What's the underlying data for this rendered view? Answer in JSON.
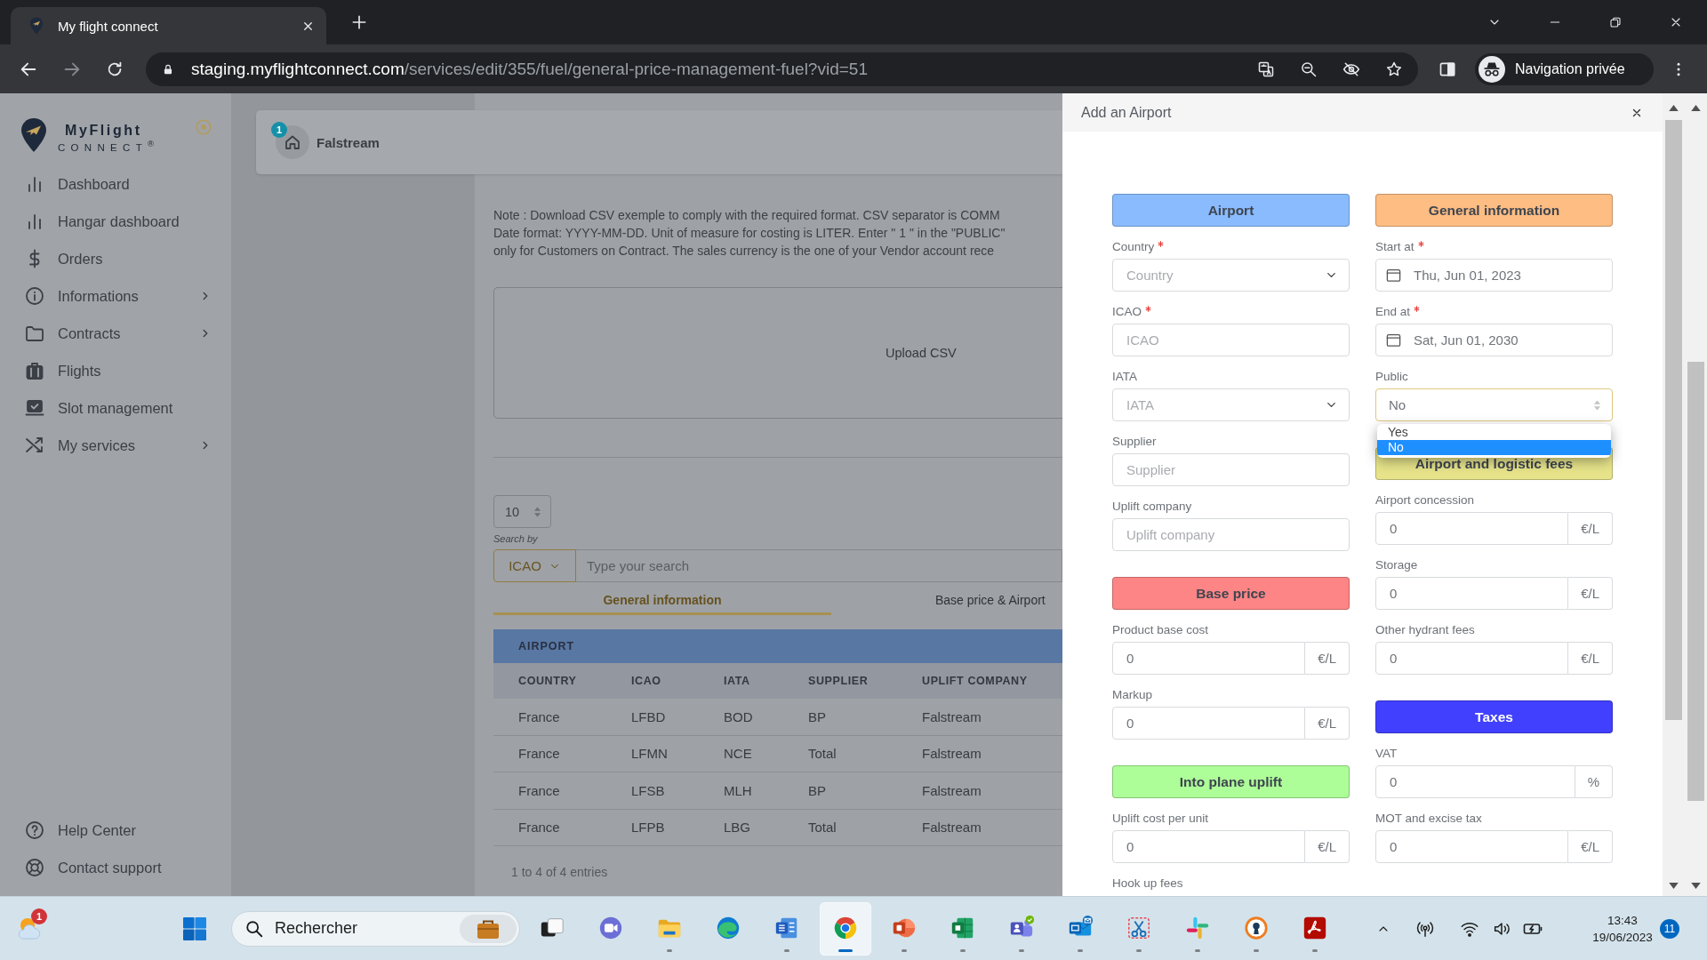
{
  "browser": {
    "tab": {
      "title": "My flight connect"
    },
    "address": {
      "host": "staging.myflightconnect.com",
      "path": "/services/edit/355/fuel/general-price-management-fuel?vid=51"
    },
    "profile": {
      "label": "Navigation privée"
    }
  },
  "sidebar": {
    "logo": {
      "name": "MyFlight",
      "tagline": "CONNECT$^{®}$"
    },
    "items": [
      {
        "label": "Dashboard",
        "expandable": false,
        "selected": false
      },
      {
        "label": "Hangar dashboard",
        "expandable": false,
        "selected": false
      },
      {
        "label": "Orders",
        "expandable": false,
        "selected": false
      },
      {
        "label": "Informations",
        "expandable": true,
        "selected": false
      },
      {
        "label": "Contracts",
        "expandable": true,
        "selected": false
      },
      {
        "label": "Flights",
        "expandable": false,
        "selected": false
      },
      {
        "label": "Slot management",
        "expandable": false,
        "selected": false
      },
      {
        "label": "My services",
        "expandable": true,
        "selected": false
      }
    ],
    "footer_items": [
      {
        "label": "Help Center",
        "expandable": false,
        "selected": false
      },
      {
        "label": "Contact support",
        "expandable": false,
        "selected": false
      }
    ]
  },
  "header": {
    "badge": "1",
    "company": "Falstream"
  },
  "content": {
    "note_lines": [
      "Note : Download CSV exemple to comply with the required format. CSV separator is COMM",
      "Date format: YYYY-MM-DD. Unit of measure for costing is LITER. Enter \" 1 \" in the \"PUBLIC\"",
      "only for Customers on Contract. The sales currency is the one of your Vendor account rece"
    ],
    "upload": {
      "label": "Upload CSV"
    },
    "page_size": {
      "value": "10"
    },
    "search": {
      "label": "Search by",
      "by": "ICAO",
      "placeholder": "Type your search"
    },
    "tabs": [
      {
        "label": "General information",
        "selected": true
      },
      {
        "label": "Base price & Airport",
        "selected": false
      }
    ],
    "table": {
      "group": "AIRPORT",
      "columns": [
        "COUNTRY",
        "ICAO",
        "IATA",
        "SUPPLIER",
        "UPLIFT COMPANY"
      ],
      "rows": [
        [
          "France",
          "LFBD",
          "BOD",
          "BP",
          "Falstream"
        ],
        [
          "France",
          "LFMN",
          "NCE",
          "Total",
          "Falstream"
        ],
        [
          "France",
          "LFSB",
          "MLH",
          "BP",
          "Falstream"
        ],
        [
          "France",
          "LFPB",
          "LBG",
          "Total",
          "Falstream"
        ]
      ]
    },
    "entries": "1 to 4 of 4 entries"
  },
  "modal": {
    "title": "Add an Airport",
    "columns": [
      {
        "sections": [
          {
            "title": "Airport",
            "color": "#89bbfe",
            "fields": [
              {
                "kind": "select",
                "label": "Country",
                "required": true,
                "placeholder": "Country"
              },
              {
                "kind": "text",
                "label": "ICAO",
                "required": true,
                "placeholder": "ICAO"
              },
              {
                "kind": "select",
                "label": "IATA",
                "required": false,
                "placeholder": "IATA"
              },
              {
                "kind": "text",
                "label": "Supplier",
                "required": false,
                "placeholder": "Supplier"
              },
              {
                "kind": "text",
                "label": "Uplift company",
                "required": false,
                "placeholder": "Uplift company"
              }
            ]
          },
          {
            "title": "Base price",
            "color": "#fd8585",
            "fields": [
              {
                "kind": "unit",
                "label": "Product base cost",
                "required": false,
                "value": "0",
                "unit": "€/L"
              },
              {
                "kind": "unit",
                "label": "Markup",
                "required": false,
                "value": "0",
                "unit": "€/L"
              }
            ]
          },
          {
            "title": "Into plane uplift",
            "color": "#adfd98",
            "fields": [
              {
                "kind": "unit",
                "label": "Uplift cost per unit",
                "required": false,
                "value": "0",
                "unit": "€/L"
              },
              {
                "kind": "label",
                "label": "Hook up fees",
                "required": false
              }
            ]
          }
        ]
      },
      {
        "sections": [
          {
            "title": "General information",
            "color": "#fdbd83",
            "fields": [
              {
                "kind": "date",
                "label": "Start at",
                "required": true,
                "value": "Thu, Jun 01, 2023"
              },
              {
                "kind": "date",
                "label": "End at",
                "required": true,
                "value": "Sat, Jun 01, 2030"
              },
              {
                "kind": "choice",
                "label": "Public",
                "required": false,
                "value": "No",
                "open": true,
                "options": [
                  {
                    "label": "Yes",
                    "selected": false
                  },
                  {
                    "label": "No",
                    "selected": true
                  }
                ]
              }
            ]
          },
          {
            "title": "Airport and logistic fees",
            "color": "#e6e38a",
            "fields": [
              {
                "kind": "unit",
                "label": "Airport concession",
                "required": false,
                "value": "0",
                "unit": "€/L"
              },
              {
                "kind": "unit",
                "label": "Storage",
                "required": false,
                "value": "0",
                "unit": "€/L"
              },
              {
                "kind": "unit",
                "label": "Other hydrant fees",
                "required": false,
                "value": "0",
                "unit": "€/L"
              }
            ]
          },
          {
            "title": "Taxes",
            "color": "#4040fe",
            "fields": [
              {
                "kind": "unit",
                "label": "VAT",
                "required": false,
                "value": "0",
                "unit": "%"
              },
              {
                "kind": "unit",
                "label": "MOT and excise tax",
                "required": false,
                "value": "0",
                "unit": "€/L"
              }
            ]
          }
        ]
      }
    ]
  },
  "taskbar": {
    "weather": {
      "badge": "1"
    },
    "search": {
      "placeholder": "Rechercher"
    },
    "apps": [
      {
        "running": false,
        "selected": false
      },
      {
        "running": false,
        "selected": false
      },
      {
        "running": true,
        "selected": false
      },
      {
        "running": false,
        "selected": false
      },
      {
        "running": true,
        "selected": false
      },
      {
        "running": true,
        "selected": true
      },
      {
        "running": true,
        "selected": false
      },
      {
        "running": true,
        "selected": false
      },
      {
        "running": true,
        "selected": false
      },
      {
        "running": true,
        "selected": false
      },
      {
        "running": true,
        "selected": false
      },
      {
        "running": true,
        "selected": false
      },
      {
        "running": true,
        "selected": false
      },
      {
        "running": true,
        "selected": false
      }
    ],
    "clock": {
      "time": "13:43",
      "date": "19/06/2023"
    },
    "notifications": {
      "count": "11"
    }
  }
}
